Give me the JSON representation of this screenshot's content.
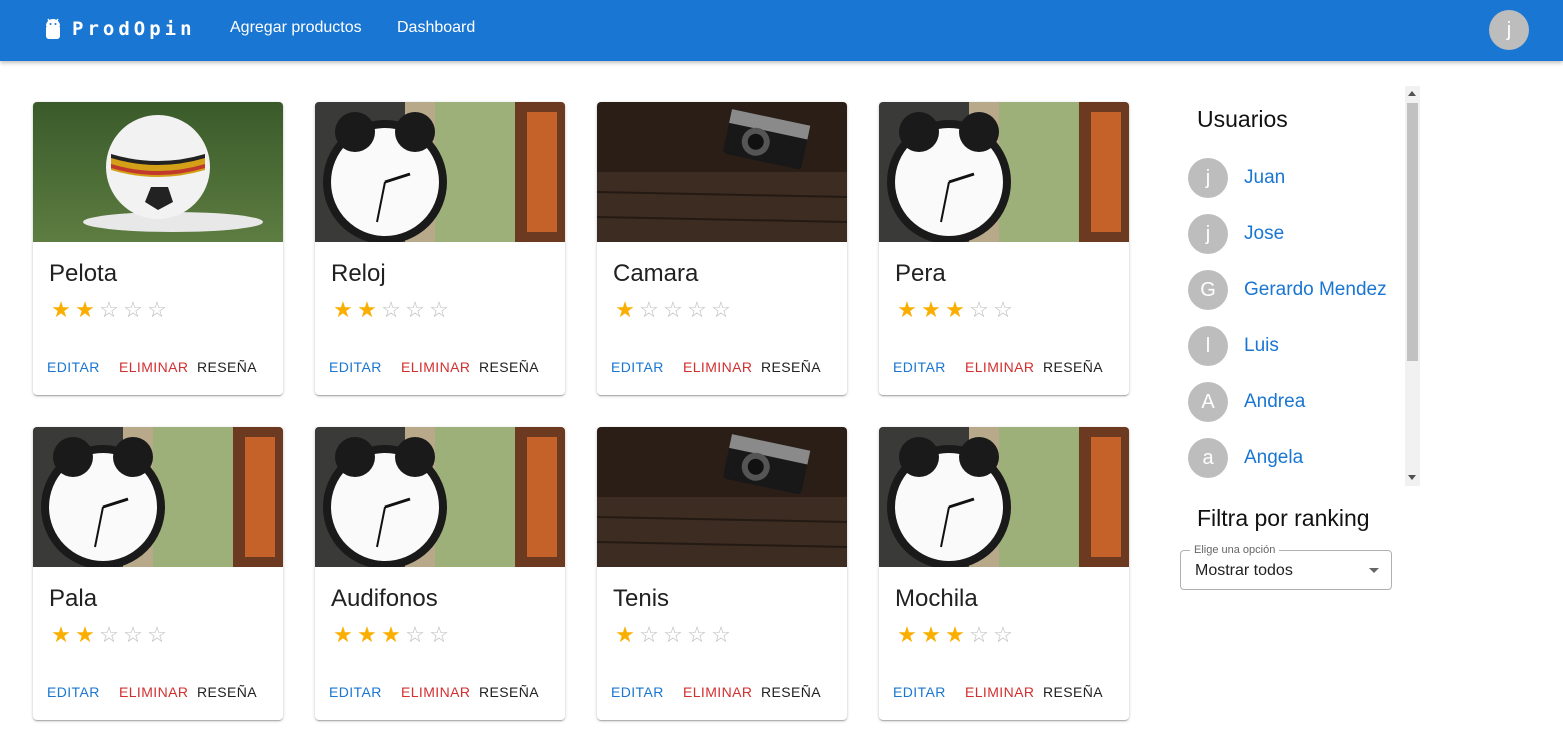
{
  "header": {
    "brand": "ProdOpin",
    "nav": [
      "Agregar productos",
      "Dashboard"
    ],
    "avatar_letter": "j"
  },
  "products": [
    {
      "title": "Pelota",
      "rating": 2,
      "image": "soccer-ball-photo"
    },
    {
      "title": "Reloj",
      "rating": 2,
      "image": "alarm-clock-photo"
    },
    {
      "title": "Camara",
      "rating": 1,
      "image": "camera-photo"
    },
    {
      "title": "Pera",
      "rating": 3,
      "image": "alarm-clock-photo"
    },
    {
      "title": "Pala",
      "rating": 2,
      "image": "alarm-clock-photo"
    },
    {
      "title": "Audifonos",
      "rating": 3,
      "image": "alarm-clock-photo"
    },
    {
      "title": "Tenis",
      "rating": 1,
      "image": "camera-photo"
    },
    {
      "title": "Mochila",
      "rating": 3,
      "image": "alarm-clock-photo"
    }
  ],
  "rating_max": 5,
  "card_actions": {
    "edit": "EDITAR",
    "delete": "ELIMINAR",
    "review": "RESEÑA"
  },
  "users_panel": {
    "title": "Usuarios",
    "users": [
      {
        "initial": "j",
        "name": "Juan"
      },
      {
        "initial": "j",
        "name": "Jose"
      },
      {
        "initial": "G",
        "name": "Gerardo Mendez"
      },
      {
        "initial": "l",
        "name": "Luis"
      },
      {
        "initial": "A",
        "name": "Andrea"
      },
      {
        "initial": "a",
        "name": "Angela"
      }
    ]
  },
  "filter": {
    "title": "Filtra por ranking",
    "label": "Elige una opción",
    "value": "Mostrar todos"
  },
  "colors": {
    "primary": "#1976d2",
    "danger": "#d32f2f",
    "star": "#faaf00"
  }
}
